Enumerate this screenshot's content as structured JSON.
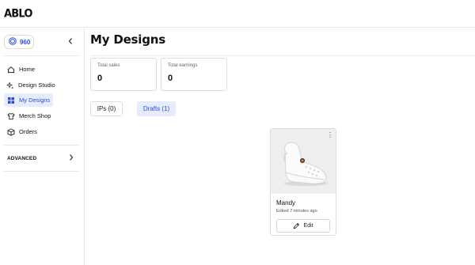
{
  "app": {
    "logo_text": "ABLO"
  },
  "sidebar": {
    "credits": "960",
    "items": [
      {
        "label": "Home",
        "icon": "home-icon"
      },
      {
        "label": "Design Studio",
        "icon": "sparkles-icon"
      },
      {
        "label": "My Designs",
        "icon": "grid-icon",
        "active": true
      },
      {
        "label": "Merch Shop",
        "icon": "shirt-icon"
      },
      {
        "label": "Orders",
        "icon": "box-icon"
      }
    ],
    "advanced_label": "ADVANCED"
  },
  "main": {
    "title": "My Designs",
    "stats": [
      {
        "label": "Total sales",
        "value": "0"
      },
      {
        "label": "Total earnings",
        "value": "0"
      }
    ],
    "tabs": [
      {
        "label": "IPs (0)"
      },
      {
        "label": "Drafts (1)",
        "active": true
      }
    ],
    "designs": [
      {
        "name": "Mandy",
        "meta": "Edited 7 minutes ago",
        "edit_label": "Edit"
      }
    ]
  },
  "colors": {
    "accent": "#2b4fd6",
    "active_bg": "#e6ecfb",
    "border": "#dedede"
  }
}
